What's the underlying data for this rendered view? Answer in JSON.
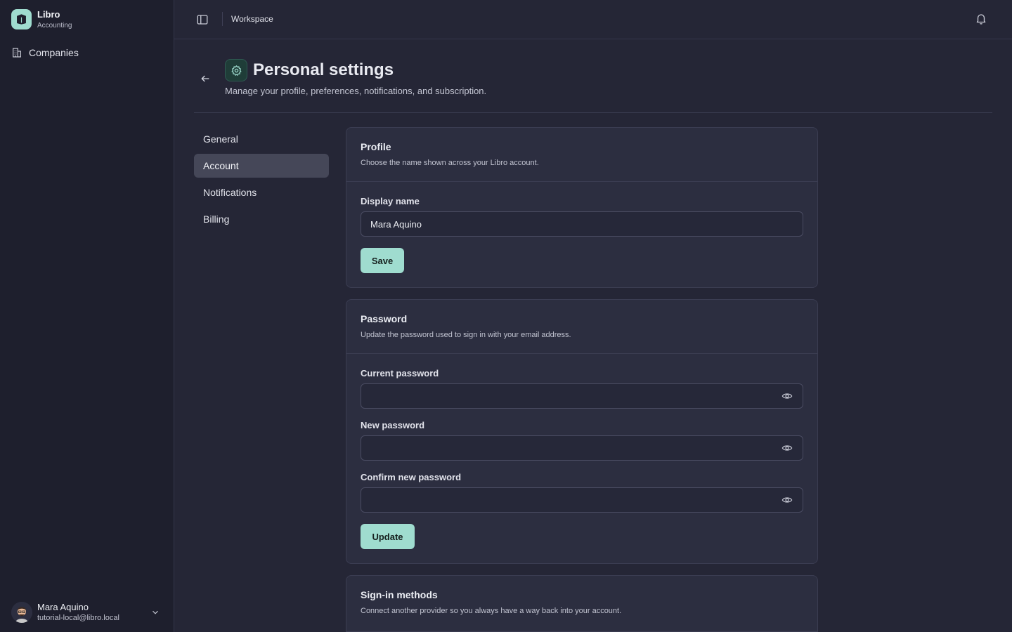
{
  "sidebar": {
    "brand_name": "Libro",
    "brand_sub": "Accounting",
    "nav": [
      {
        "label": "Companies",
        "icon": "building-icon"
      }
    ],
    "user": {
      "name": "Mara Aquino",
      "email": "tutorial-local@libro.local"
    }
  },
  "topbar": {
    "breadcrumb": "Workspace"
  },
  "header": {
    "title": "Personal settings",
    "subtitle": "Manage your profile, preferences, notifications, and subscription."
  },
  "tabs": [
    {
      "label": "General",
      "active": false
    },
    {
      "label": "Account",
      "active": true
    },
    {
      "label": "Notifications",
      "active": false
    },
    {
      "label": "Billing",
      "active": false
    }
  ],
  "profile": {
    "title": "Profile",
    "description": "Choose the name shown across your Libro account.",
    "display_name_label": "Display name",
    "display_name_value": "Mara Aquino",
    "save_label": "Save"
  },
  "password": {
    "title": "Password",
    "description": "Update the password used to sign in with your email address.",
    "current_label": "Current password",
    "new_label": "New password",
    "confirm_label": "Confirm new password",
    "update_label": "Update"
  },
  "signin": {
    "title": "Sign-in methods",
    "description": "Connect another provider so you always have a way back into your account."
  },
  "colors": {
    "accent": "#9fdccf",
    "background": "#252636",
    "sidebar": "#1e1f2d",
    "card": "#2c2e40"
  }
}
